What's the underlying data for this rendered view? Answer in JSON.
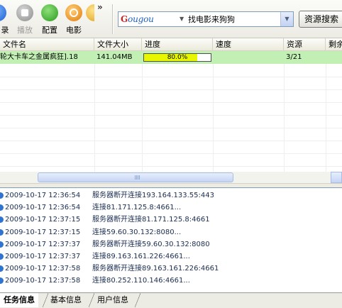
{
  "toolbar": {
    "buttons": [
      {
        "label": "录",
        "icon": "partial-icon",
        "disabled": false
      },
      {
        "label": "播放",
        "icon": "play-icon",
        "disabled": true
      },
      {
        "label": "配置",
        "icon": "gear-icon",
        "disabled": false
      },
      {
        "label": "电影",
        "icon": "movie-icon",
        "disabled": false
      },
      {
        "label": "",
        "icon": "partial-icon",
        "disabled": false
      }
    ],
    "overflow": "»",
    "search_engine": {
      "logo_prefix": "G",
      "logo_text": "ougou"
    },
    "search_value": "找电影来狗狗",
    "search_button": "资源搜索"
  },
  "list": {
    "columns": [
      "文件名",
      "文件大小",
      "进度",
      "速度",
      "资源",
      "剩余"
    ],
    "rows": [
      {
        "name": "轮大卡车之金属疯狂].18",
        "size": "141.04MB",
        "progress_text": "80.0%",
        "progress": 0.8,
        "speed": "",
        "sources": "3/21",
        "remaining": ""
      }
    ]
  },
  "log": [
    {
      "time": "2009-10-17 12:36:54",
      "msg": "服务器断开连接193.164.133.55:443"
    },
    {
      "time": "2009-10-17 12:36:54",
      "msg": "连接81.171.125.8:4661..."
    },
    {
      "time": "2009-10-17 12:37:15",
      "msg": "服务器断开连接81.171.125.8:4661"
    },
    {
      "time": "2009-10-17 12:37:15",
      "msg": "连接59.60.30.132:8080..."
    },
    {
      "time": "2009-10-17 12:37:37",
      "msg": "服务器断开连接59.60.30.132:8080"
    },
    {
      "time": "2009-10-17 12:37:37",
      "msg": "连接89.163.161.226:4661..."
    },
    {
      "time": "2009-10-17 12:37:58",
      "msg": "服务器断开连接89.163.161.226:4661"
    },
    {
      "time": "2009-10-17 12:37:58",
      "msg": "连接80.252.110.146:4661..."
    }
  ],
  "tabs": [
    {
      "label": "任务信息",
      "active": true
    },
    {
      "label": "基本信息",
      "active": false
    },
    {
      "label": "用户信息",
      "active": false
    }
  ],
  "colors": {
    "row_highlight": "#c2f0b4",
    "progress_fill": "#e8f600",
    "log_text": "#1a2c50"
  }
}
